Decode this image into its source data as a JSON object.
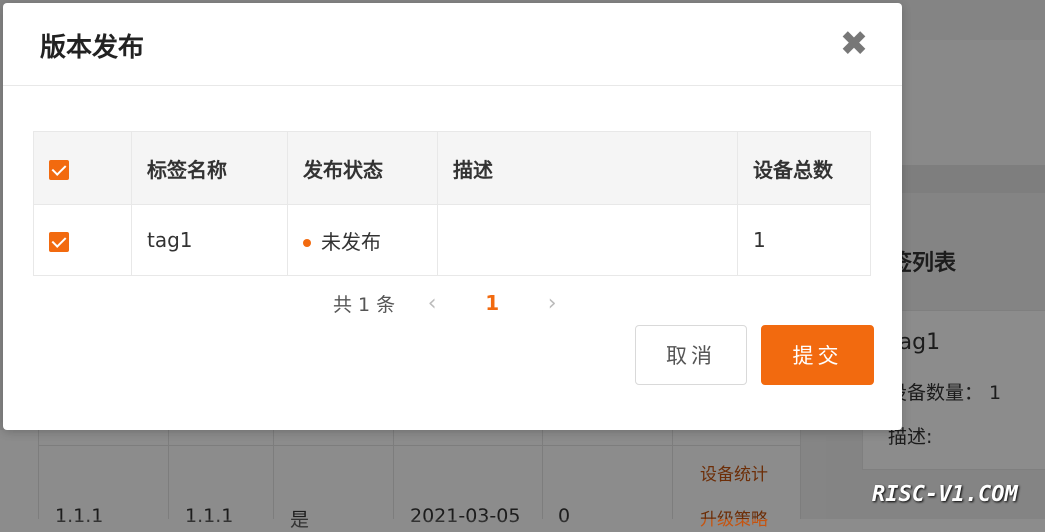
{
  "modal": {
    "title": "版本发布",
    "close_symbol": "✖",
    "table": {
      "headers": [
        "标签名称",
        "发布状态",
        "描述",
        "设备总数"
      ],
      "rows": [
        {
          "checked": true,
          "name": "tag1",
          "status": "未发布",
          "description": "",
          "device_total": "1"
        }
      ]
    },
    "pagination": {
      "total_text": "共 1 条",
      "current_page": "1",
      "prev_symbol": "‹",
      "next_symbol": "›"
    },
    "buttons": {
      "cancel": "取消",
      "submit": "提交"
    }
  },
  "background": {
    "right_panel": {
      "title": "签列表",
      "card_title": "tag1",
      "device_count": "设备数量：  1",
      "description": "描述:"
    },
    "table_cells": [
      "1.1.1",
      "1.1.1",
      "是",
      "2021-03-05",
      "0"
    ],
    "links": [
      "设备统计",
      "升级策略"
    ]
  },
  "watermark": "RISC-V1.COM",
  "colors": {
    "accent": "#f26a0f",
    "link": "#c6540f"
  }
}
